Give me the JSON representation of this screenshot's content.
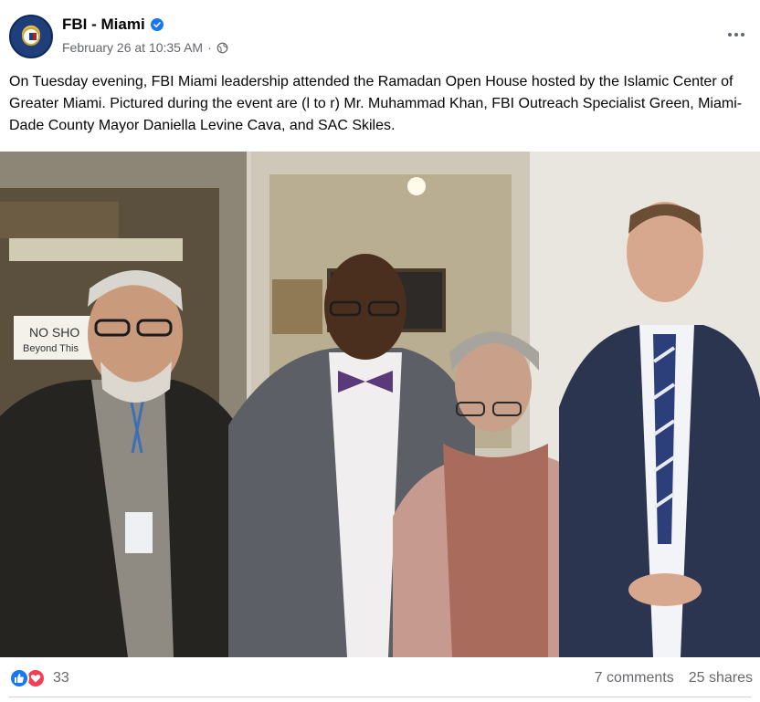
{
  "post": {
    "page_name": "FBI - Miami",
    "verified": true,
    "timestamp": "February 26 at 10:35 AM",
    "separator": "·",
    "audience_icon": "globe-icon",
    "more_icon": "more-options-icon",
    "text": "On Tuesday evening, FBI Miami leadership attended the Ramadan Open House hosted by the Islamic Center of Greater Miami. Pictured during the event are (l to r) Mr. Muhammad Khan, FBI Outreach Specialist Green, Miami-Dade County Mayor Daniella Levine Cava, and SAC Skiles."
  },
  "photo": {
    "sign_line1": "NO SHO",
    "sign_line2": "Beyond This"
  },
  "footer": {
    "reaction_icons": [
      "like-icon",
      "love-icon"
    ],
    "reaction_count": "33",
    "comments": "7 comments",
    "shares": "25 shares"
  },
  "colors": {
    "brand_blue": "#1877f2",
    "love_red": "#f33e58",
    "secondary_text": "#65676b"
  }
}
